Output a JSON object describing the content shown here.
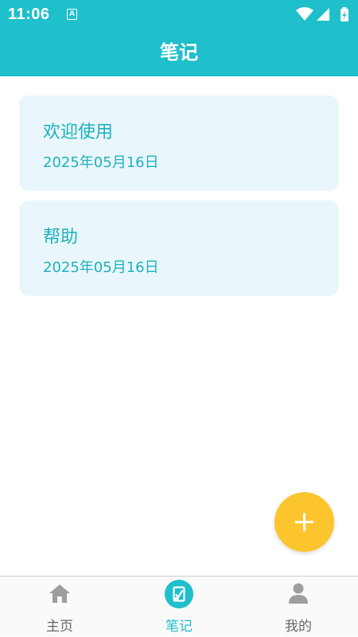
{
  "status_bar": {
    "time": "11:06",
    "notification_glyph": "A",
    "icons": [
      "wifi-icon",
      "signal-icon",
      "battery-charging-icon"
    ]
  },
  "app_bar": {
    "title": "笔记"
  },
  "notes": [
    {
      "title": "欢迎使用",
      "date": "2025年05月16日"
    },
    {
      "title": "帮助",
      "date": "2025年05月16日"
    }
  ],
  "fab": {
    "icon": "plus-icon",
    "color": "#fcc52e"
  },
  "tabs": [
    {
      "label": "主页",
      "icon": "home-icon",
      "active": false
    },
    {
      "label": "笔记",
      "icon": "note-icon",
      "active": true
    },
    {
      "label": "我的",
      "icon": "person-icon",
      "active": false
    }
  ],
  "colors": {
    "primary": "#1fbfcb",
    "card_bg": "#e9f7fd",
    "accent": "#fcc52e"
  }
}
